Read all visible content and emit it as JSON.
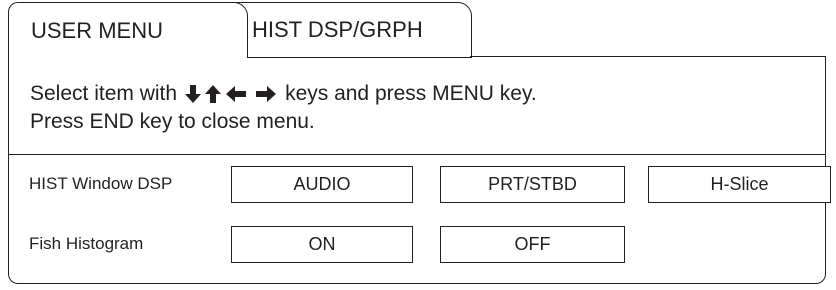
{
  "tabs": [
    {
      "label": "USER MENU"
    },
    {
      "label": "HIST DSP/GRPH"
    }
  ],
  "instructions": {
    "line1_prefix": "Select item with",
    "line1_suffix": "keys and press MENU key.",
    "line2": "Press END key to close menu.",
    "arrow_icons": [
      "arrow-down-icon",
      "arrow-up-icon",
      "arrow-left-icon",
      "arrow-right-icon"
    ]
  },
  "rows": [
    {
      "label": "HIST Window DSP",
      "options": [
        "AUDIO",
        "PRT/STBD",
        "H-Slice"
      ]
    },
    {
      "label": "Fish Histogram",
      "options": [
        "ON",
        "OFF"
      ]
    }
  ],
  "colors": {
    "ink": "#231f20",
    "background": "#ffffff"
  }
}
